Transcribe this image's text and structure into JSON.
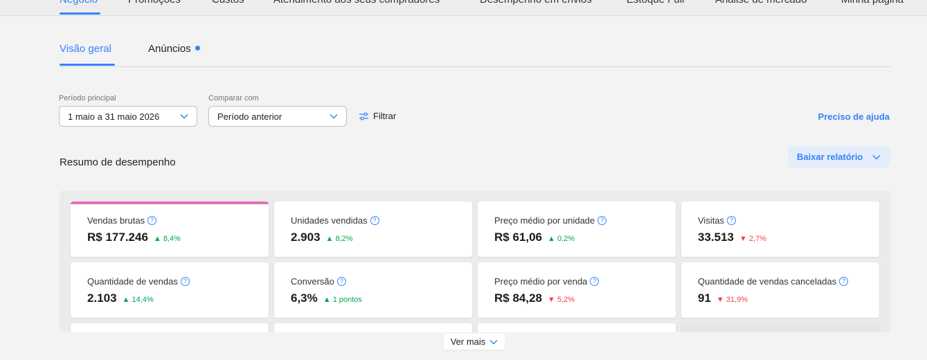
{
  "topnav": {
    "items": [
      "Negócio",
      "Promoções",
      "Custos",
      "Atendimento aos seus compradores",
      "Desempenho em envios",
      "Estoque Full",
      "Análise de mercado",
      "Minha página"
    ]
  },
  "tabs": [
    {
      "label": "Visão geral",
      "active": true
    },
    {
      "label": "Anúncios",
      "active": false
    }
  ],
  "filters": {
    "period_label": "Período principal",
    "period_value": "1 maio a 31 maio 2026",
    "compare_label": "Comparar com",
    "compare_value": "Período anterior",
    "filter_label": "Filtrar",
    "help_link": "Preciso de ajuda"
  },
  "summary": {
    "title": "Resumo de desempenho",
    "download_label": "Baixar relatório"
  },
  "metrics": [
    {
      "title": "Vendas brutas",
      "value": "R$ 177.246",
      "delta": "8,4%",
      "direction": "up"
    },
    {
      "title": "Unidades vendidas",
      "value": "2.903",
      "delta": "8,2%",
      "direction": "up"
    },
    {
      "title": "Preço médio por unidade",
      "value": "R$ 61,06",
      "delta": "0,2%",
      "direction": "up"
    },
    {
      "title": "Visitas",
      "value": "33.513",
      "delta": "2,7%",
      "direction": "down"
    },
    {
      "title": "Quantidade de vendas",
      "value": "2.103",
      "delta": "14,4%",
      "direction": "up"
    },
    {
      "title": "Conversão",
      "value": "6,3%",
      "delta": "1 pontos",
      "direction": "up"
    },
    {
      "title": "Preço médio por venda",
      "value": "R$ 84,28",
      "delta": "5,2%",
      "direction": "down"
    },
    {
      "title": "Quantidade de vendas canceladas",
      "value": "91",
      "delta": "31,9%",
      "direction": "down"
    }
  ],
  "see_more": "Ver mais",
  "colors": {
    "accent": "#3483fa",
    "selected_bar": "#e86fb8",
    "up": "#00a650",
    "down": "#f23d4f"
  }
}
